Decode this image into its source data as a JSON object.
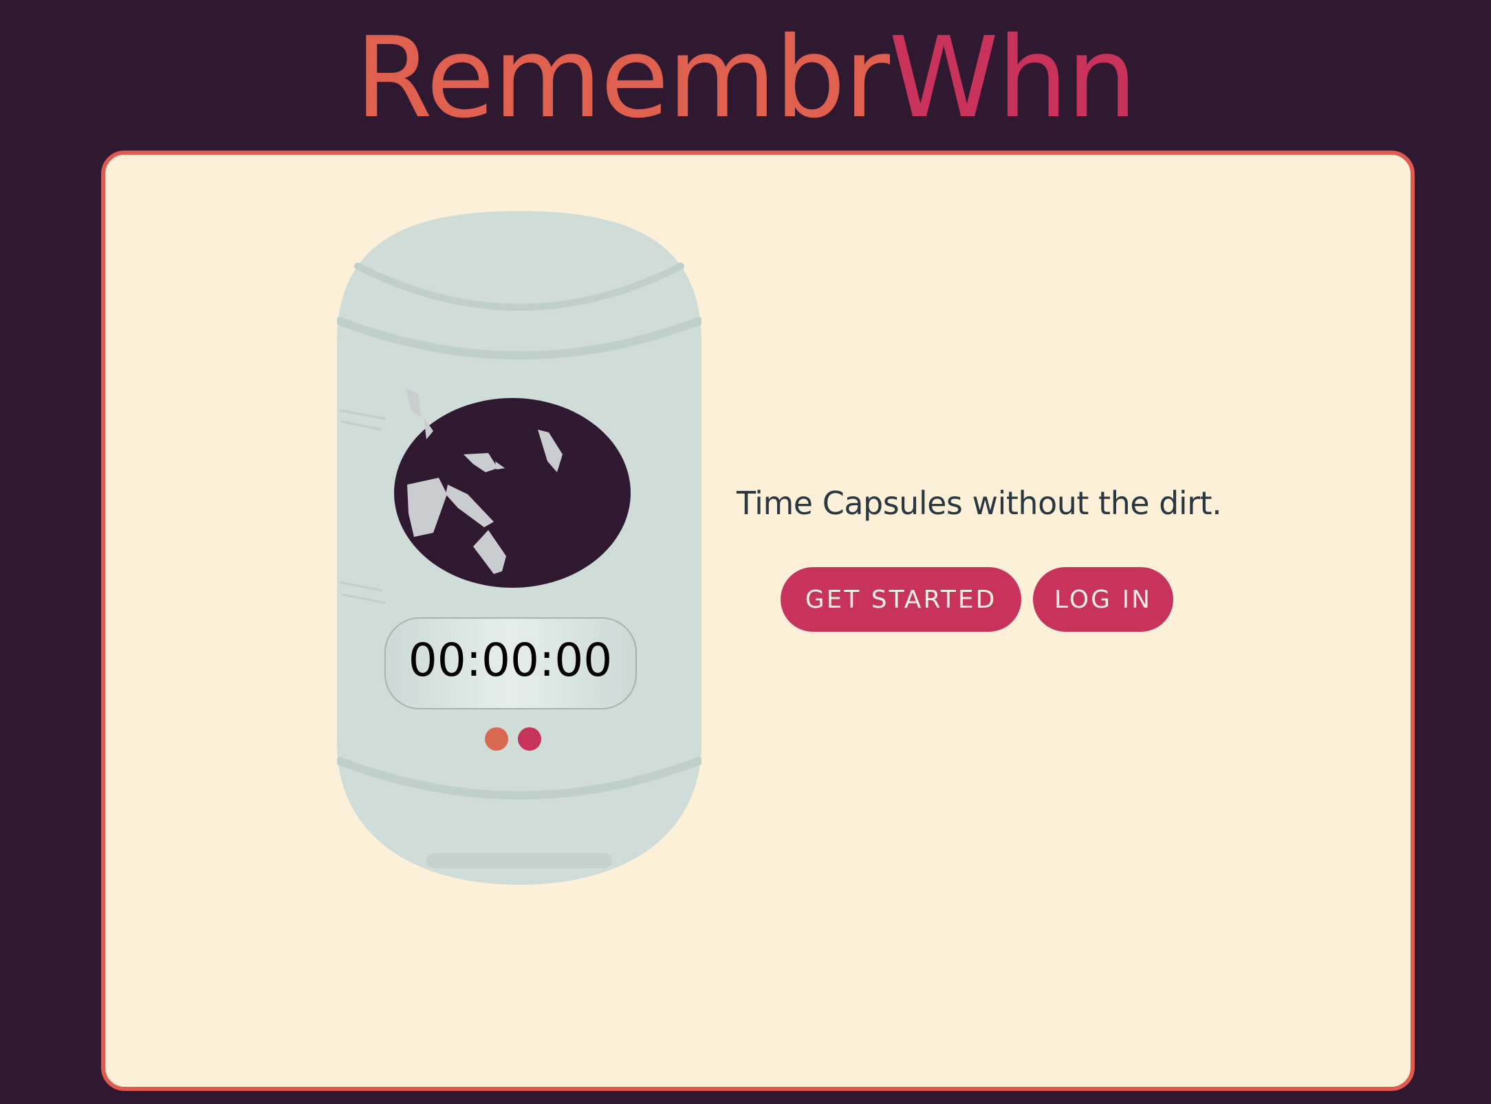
{
  "header": {
    "logo_part1": "Remembr",
    "logo_part2": "Whn"
  },
  "hero": {
    "timer": "00:00:00",
    "tagline": "Time Capsules without the dirt.",
    "get_started_label": "GET STARTED",
    "login_label": "LOG IN"
  },
  "colors": {
    "background": "#2e1931",
    "card": "#fcf1d8",
    "card_border": "#e05a4f",
    "button": "#c8335c",
    "logo_primary": "#e0604f",
    "logo_accent": "#c8325b"
  }
}
